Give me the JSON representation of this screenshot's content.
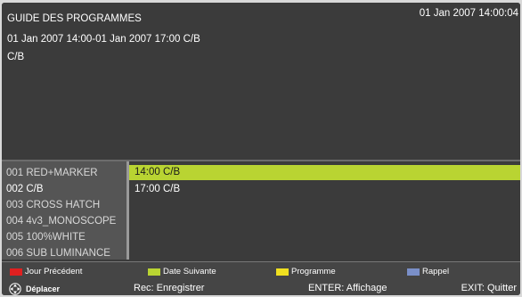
{
  "header": {
    "title": "GUIDE DES PROGRAMMES",
    "time_range": "01 Jan 2007 14:00-01 Jan 2007 17:00 C/B",
    "channel": "C/B",
    "clock": "01 Jan 2007 14:00:04"
  },
  "channels": [
    {
      "label": "001  RED+MARKER",
      "selected": false
    },
    {
      "label": "002  C/B",
      "selected": true
    },
    {
      "label": "003  CROSS HATCH",
      "selected": false
    },
    {
      "label": "004  4v3_MONOSCOPE",
      "selected": false
    },
    {
      "label": "005  100%WHITE",
      "selected": false
    },
    {
      "label": "006  SUB LUMINANCE",
      "selected": false
    }
  ],
  "events": [
    {
      "label": "14:00 C/B",
      "highlighted": true
    },
    {
      "label": "17:00 C/B",
      "highlighted": false
    }
  ],
  "footer": {
    "legend": {
      "red": {
        "label": "Jour  Précédent",
        "color": "#e02020"
      },
      "green": {
        "label": "Date Suivante",
        "color": "#b9d432"
      },
      "yellow": {
        "label": "Programme",
        "color": "#f0e020"
      },
      "blue": {
        "label": "Rappel",
        "color": "#7a8fc8"
      }
    },
    "move_label": "Déplacer",
    "move_icon": "dpad-icon",
    "rec_label": "Rec: Enregistrer",
    "enter_label": "ENTER: Affichage",
    "exit_label": "EXIT: Quitter"
  }
}
